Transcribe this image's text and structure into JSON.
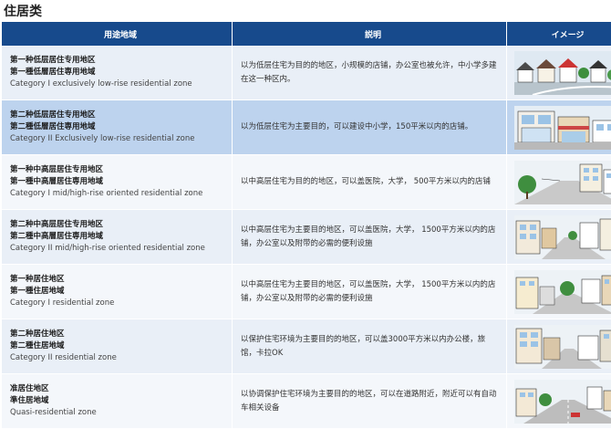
{
  "page": {
    "title": "住居类"
  },
  "table": {
    "headers": {
      "use": "用途地域",
      "explanation": "説明",
      "image": "イメージ"
    },
    "rows": [
      {
        "zh": "第一种低层居住专用地区",
        "ja": "第一種低層居住専用地域",
        "en": "Category I exclusively low-rise residential zone",
        "desc": "以为低层住宅为目的的地区，小规模的店铺，办公室也被允许，中小学多建在这一种区内。",
        "icon": "low-rise-houses"
      },
      {
        "zh": "第二种低层居住专用地区",
        "ja": "第二種低層居住専用地域",
        "en": "Category II Exclusively low-rise residential zone",
        "desc": "以为低层住宅为主要目的，可以建设中小学，150平米以内的店铺。",
        "icon": "storefront-street"
      },
      {
        "zh": "第一种中高层居住专用地区",
        "ja": "第一種中高層居住専用地域",
        "en": "Category I mid/high-rise oriented residential zone",
        "desc": "以中高层住宅为目的的地区，可以盖医院，大学， 500平方米以内的店铺",
        "icon": "midrise-street"
      },
      {
        "zh": "第二种中高层居住专用地区",
        "ja": "第二種中高層居住専用地域",
        "en": "Category II mid/high-rise oriented residential zone",
        "desc": "以中高层住宅为主要目的地区，可以盖医院，大学， 1500平方米以内的店铺，办公室以及附带的必需的便利设施",
        "icon": "midrise-street-2"
      },
      {
        "zh": "第一种居住地区",
        "ja": "第一種住居地域",
        "en": "Category I residential zone",
        "desc": "以中高层住宅为主要目的地区，可以盖医院，大学， 1500平方米以内的店铺，办公室以及附带的必需的便利设施",
        "icon": "residential-street"
      },
      {
        "zh": "第二种居住地区",
        "ja": "第二種住居地域",
        "en": "Category II residential zone",
        "desc": "以保护住宅环境为主要目的的地区，可以盖3000平方米以内办公楼，旅馆，卡拉OK",
        "icon": "mixed-street"
      },
      {
        "zh": "准居住地区",
        "ja": "準住居地域",
        "en": "Quasi-residential zone",
        "desc": "以协调保护住宅环境为主要目的的地区，可以在道路附近，附近可以有自动车相关设备",
        "icon": "roadside-street"
      }
    ]
  }
}
